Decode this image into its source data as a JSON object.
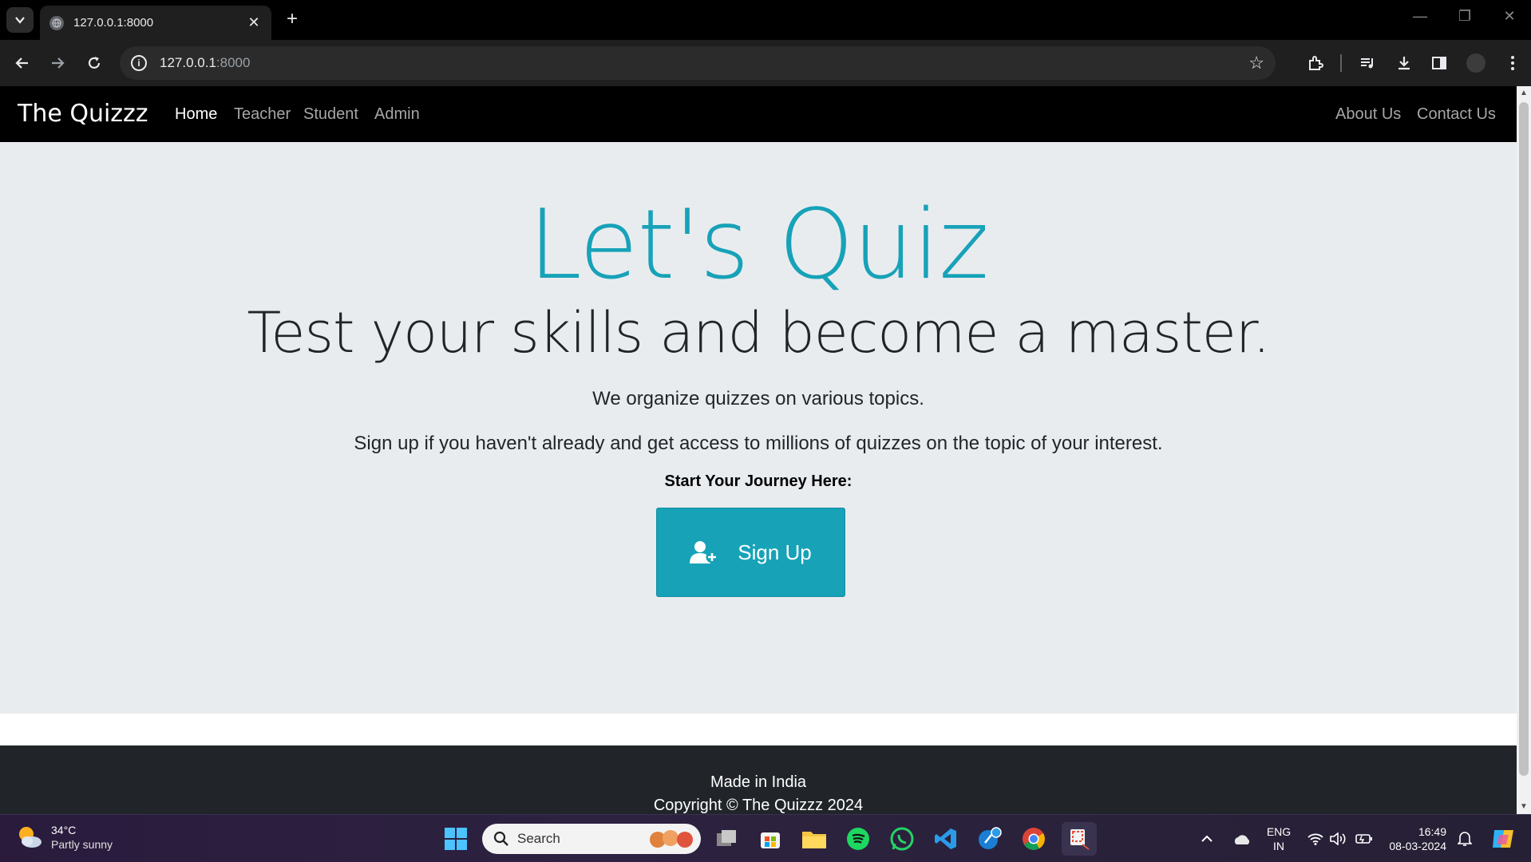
{
  "browser": {
    "tab_title": "127.0.0.1:8000",
    "url_host": "127.0.0.1",
    "url_port": ":8000"
  },
  "site": {
    "brand": "The Quizzz",
    "nav_left": [
      "Home",
      "Teacher",
      "Student",
      "Admin"
    ],
    "nav_right": [
      "About Us",
      "Contact Us"
    ],
    "active_nav": "Home"
  },
  "hero": {
    "title": "Let's Quiz",
    "subtitle": "Test your skills and become a master.",
    "text1": "We organize quizzes on various topics.",
    "text2": "Sign up if you haven't already and get access to millions of quizzes on the topic of your interest.",
    "cta_label": "Start Your Journey Here:",
    "button_label": "Sign Up"
  },
  "footer": {
    "line1": "Made in India",
    "line2": "Copyright © The Quizzz 2024"
  },
  "taskbar": {
    "temperature": "34°C",
    "condition": "Partly sunny",
    "search_label": "Search",
    "lang_line1": "ENG",
    "lang_line2": "IN",
    "time": "16:49",
    "date": "08-03-2024"
  },
  "colors": {
    "accent": "#17a2b8",
    "hero_bg": "#e9ecef",
    "footer_bg": "#212529",
    "nav_bg": "#000000"
  },
  "icons": [
    "tab-search-icon",
    "globe-icon",
    "close-icon",
    "plus-icon",
    "back-icon",
    "forward-icon",
    "reload-icon",
    "info-icon",
    "star-icon",
    "extensions-icon",
    "media-icon",
    "download-icon",
    "sidepanel-icon",
    "menu-icon",
    "user-plus-icon",
    "windows-icon",
    "search-icon"
  ]
}
